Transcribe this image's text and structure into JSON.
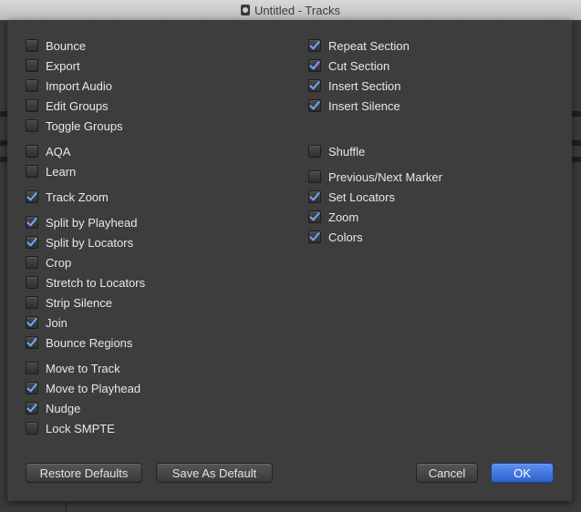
{
  "window": {
    "title": "Untitled - Tracks"
  },
  "left_column": [
    {
      "label": "Bounce",
      "checked": false
    },
    {
      "label": "Export",
      "checked": false
    },
    {
      "label": "Import Audio",
      "checked": false
    },
    {
      "label": "Edit Groups",
      "checked": false
    },
    {
      "label": "Toggle Groups",
      "checked": false
    },
    {
      "label": "AQA",
      "checked": false
    },
    {
      "label": "Learn",
      "checked": false
    },
    {
      "label": "Track Zoom",
      "checked": true
    },
    {
      "label": "Split by Playhead",
      "checked": true
    },
    {
      "label": "Split by Locators",
      "checked": true
    },
    {
      "label": "Crop",
      "checked": false
    },
    {
      "label": "Stretch to Locators",
      "checked": false
    },
    {
      "label": "Strip Silence",
      "checked": false
    },
    {
      "label": "Join",
      "checked": true
    },
    {
      "label": "Bounce Regions",
      "checked": true
    },
    {
      "label": "Move to Track",
      "checked": false
    },
    {
      "label": "Move to Playhead",
      "checked": true
    },
    {
      "label": "Nudge",
      "checked": true
    },
    {
      "label": "Lock SMPTE",
      "checked": false
    }
  ],
  "right_column": [
    {
      "label": "Repeat Section",
      "checked": true
    },
    {
      "label": "Cut Section",
      "checked": true
    },
    {
      "label": "Insert Section",
      "checked": true
    },
    {
      "label": "Insert Silence",
      "checked": true
    },
    {
      "label": "Shuffle",
      "checked": false
    },
    {
      "label": "Previous/Next Marker",
      "checked": false
    },
    {
      "label": "Set Locators",
      "checked": true
    },
    {
      "label": "Zoom",
      "checked": true
    },
    {
      "label": "Colors",
      "checked": true
    }
  ],
  "buttons": {
    "restore_defaults": "Restore Defaults",
    "save_as_default": "Save As Default",
    "cancel": "Cancel",
    "ok": "OK"
  },
  "colors": {
    "accent": "#3f74e0",
    "checkmark": "#6da8ff"
  }
}
